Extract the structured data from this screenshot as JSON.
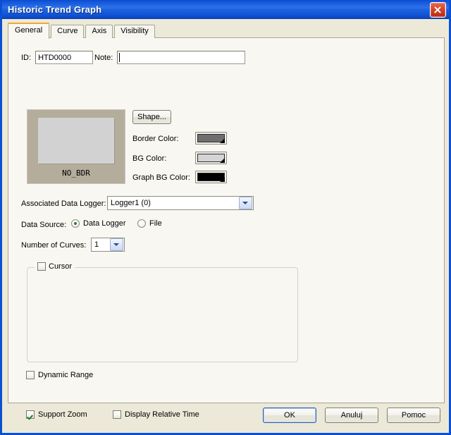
{
  "window": {
    "title": "Historic Trend Graph",
    "close_icon": "close-icon"
  },
  "tabs": [
    {
      "label": "General",
      "selected": true
    },
    {
      "label": "Curve",
      "selected": false
    },
    {
      "label": "Axis",
      "selected": false
    },
    {
      "label": "Visibility",
      "selected": false
    }
  ],
  "general": {
    "id_label": "ID:",
    "id_value": "HTD0000",
    "note_label": "Note:",
    "note_value": "",
    "note_placeholder": "",
    "preview_label": "NO_BDR",
    "preview_bg_color": "#b4ad9c",
    "preview_inner_color": "#d2d2d2",
    "shape_button": "Shape...",
    "colors": [
      {
        "label": "Border Color:",
        "value": "#6e6e6e"
      },
      {
        "label": "BG Color:",
        "value": "#d4d4d4"
      },
      {
        "label": "Graph BG Color:",
        "value": "#000000"
      }
    ],
    "data_logger_label": "Associated Data Logger:",
    "data_logger_value": "Logger1 (0)",
    "data_source_label": "Data Source:",
    "data_source_options": [
      {
        "label": "Data Logger",
        "selected": true
      },
      {
        "label": "File",
        "selected": false
      }
    ],
    "curves_label": "Number of Curves:",
    "curves_value": "1",
    "cursor_label": "Cursor",
    "cursor_checked": false,
    "dynamic_range_label": "Dynamic Range",
    "dynamic_range_checked": false,
    "support_zoom_label": "Support Zoom",
    "support_zoom_checked": true,
    "display_relative_time_label": "Display Relative Time",
    "display_relative_time_checked": false
  },
  "footer": {
    "ok": "OK",
    "cancel": "Anuluj",
    "help": "Pomoc"
  }
}
